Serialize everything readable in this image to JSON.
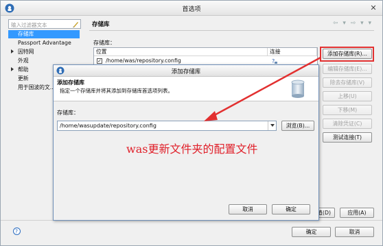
{
  "window": {
    "title": "首选项",
    "close_glyph": "✕"
  },
  "sidebar": {
    "filter_placeholder": "输入过滤器文本",
    "items": [
      {
        "label": "存储库",
        "selected": true
      },
      {
        "label": "Passport Advantage"
      },
      {
        "label": "因特网",
        "expandable": true
      },
      {
        "label": "外观"
      },
      {
        "label": "帮助",
        "expandable": true
      },
      {
        "label": "更新"
      },
      {
        "label": "用于国波的文..."
      }
    ]
  },
  "panel": {
    "title": "存储库",
    "nav_arrows": "⇦ ▾ ⇨ ▾ ▾",
    "repos_label": "存储库：",
    "table": {
      "columns": [
        "位置",
        "连接"
      ],
      "rows": [
        {
          "checked": true,
          "location": "/home/was/repository.config",
          "connection_icon": "connection-question-icon"
        }
      ]
    },
    "buttons": {
      "add": "添加存储库(R)...",
      "edit": "编辑存储库(E)...",
      "remove": "除去存储库(V)",
      "up": "上移(U)",
      "down": "下移(M)",
      "clear_credentials": "清除凭证(C)",
      "test_connection": "测试连接(T)"
    }
  },
  "footer": {
    "restore_partial": "值(D)",
    "apply": "应用(A)",
    "ok": "确定",
    "cancel": "取消",
    "help_icon": "help-icon"
  },
  "dialog": {
    "title": "添加存储库",
    "banner_title": "添加存储库",
    "banner_desc": "指定一个存储库并将其添加到存储库首选项列表。",
    "repo_label": "存储库：",
    "repo_value": "/home/wasupdate/repository.config",
    "browse": "浏览(B)...",
    "cancel": "取消",
    "ok": "确定"
  },
  "annotation": {
    "text": "was更新文件夹的配置文件",
    "color": "#e0202a"
  },
  "colors": {
    "selection": "#3399ff",
    "highlight": "#e23030"
  }
}
